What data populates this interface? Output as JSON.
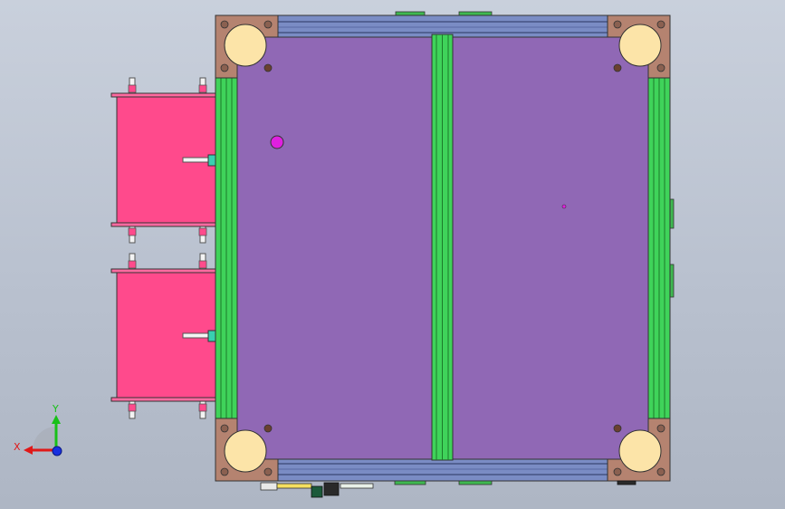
{
  "viewport": {
    "background_top": "#c9d0dc",
    "background_bottom": "#aeb6c4"
  },
  "model": {
    "plate_color": "#9068b5",
    "rail_color": "#3fd35a",
    "frame_color": "#7a8cc4",
    "bracket_color": "#b58370",
    "wheel_color": "#fce4a8",
    "actuator_color": "#ff4a8c",
    "marker_color": "#e020e0"
  },
  "triad": {
    "x_label": "X",
    "y_label": "Y",
    "x_color": "#e01818",
    "y_color": "#18c018",
    "z_color": "#1830e0"
  }
}
